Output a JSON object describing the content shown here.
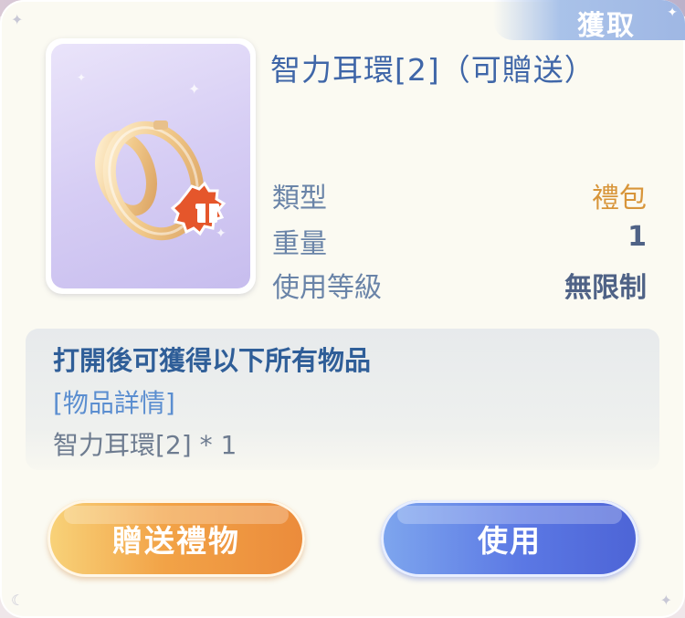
{
  "header": {
    "tab_label": "獲取"
  },
  "item": {
    "name": "智力耳環[2]（可贈送）",
    "icon": "earring-icon",
    "badge_icon": "gift-box-badge-icon"
  },
  "stats": [
    {
      "label": "類型",
      "value": "禮包"
    },
    {
      "label": "重量",
      "value": "1"
    },
    {
      "label": "使用等級",
      "value": "無限制"
    }
  ],
  "description": {
    "title": "打開後可獲得以下所有物品",
    "link": "[物品詳情]",
    "contents": "智力耳環[2] * 1"
  },
  "buttons": {
    "gift_label": "贈送禮物",
    "use_label": "使用"
  },
  "colors": {
    "name_blue": "#3f66a8",
    "type_orange": "#d8953a",
    "gift_button": "#f2a347",
    "use_button": "#5b78e4"
  }
}
